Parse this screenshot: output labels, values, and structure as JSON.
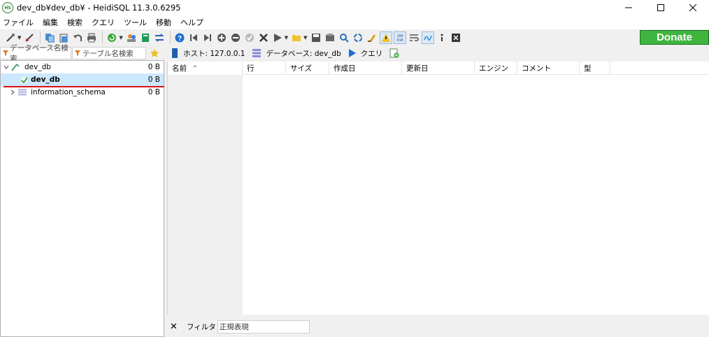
{
  "window": {
    "title": "dev_db¥dev_db¥ - HeidiSQL 11.3.0.6295",
    "icon": "heidisql-logo-icon",
    "icon_text": "HS"
  },
  "menu": [
    "ファイル",
    "編集",
    "検索",
    "クエリ",
    "ツール",
    "移動",
    "ヘルプ"
  ],
  "toolbar": {
    "donate_label": "Donate"
  },
  "filters": {
    "db_placeholder": "データベース名検索",
    "table_placeholder": "テーブル名検索"
  },
  "tabs": [
    {
      "label": "ホスト: 127.0.0.1",
      "icon": "host-icon"
    },
    {
      "label": "データベース: dev_db",
      "icon": "database-icon"
    },
    {
      "label": "クエリ",
      "icon": "run-icon"
    }
  ],
  "tree": [
    {
      "label": "dev_db",
      "size": "0 B",
      "level": 0,
      "expanded": true
    },
    {
      "label": "dev_db",
      "size": "0 B",
      "level": 1,
      "selected": true
    },
    {
      "label": "information_schema",
      "size": "0 B",
      "level": 1,
      "expanded": false
    }
  ],
  "grid": {
    "columns": [
      "名前",
      "行",
      "サイズ",
      "作成日",
      "更新日",
      "エンジン",
      "コメント",
      "型"
    ],
    "sort_indicator": "^"
  },
  "bottom": {
    "close": "✕",
    "filter_label": "フィルタ",
    "filter_value": "正規表現"
  },
  "colors": {
    "selection": "#cce8ff",
    "donate": "#3fb53f",
    "accent_red": "#d11111"
  }
}
